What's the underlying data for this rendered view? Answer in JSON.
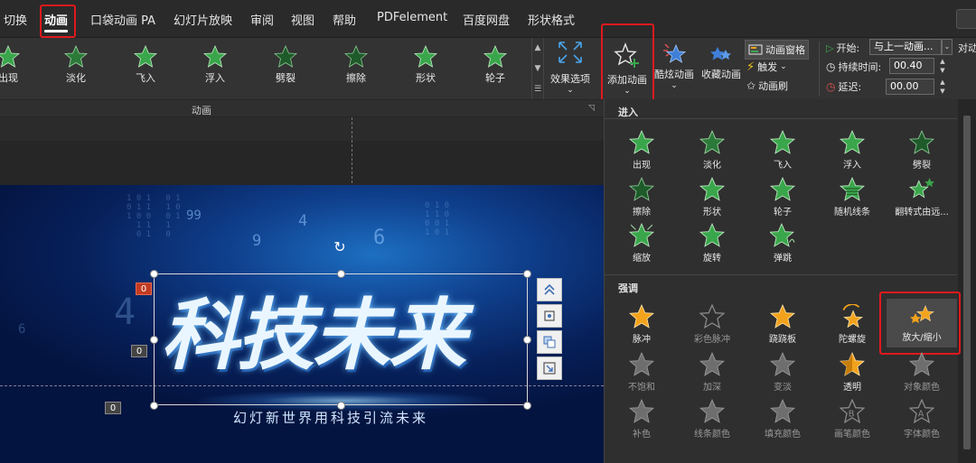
{
  "menu": {
    "tabs": [
      "切换",
      "动画",
      "口袋动画 PA",
      "幻灯片放映",
      "审阅",
      "视图",
      "帮助",
      "PDFelement",
      "百度网盘",
      "形状格式"
    ]
  },
  "ribbon": {
    "gallery": [
      "出现",
      "淡化",
      "飞入",
      "浮入",
      "劈裂",
      "擦除",
      "形状",
      "轮子"
    ],
    "effect_options_label": "效果选项",
    "add_animation_label": "添加动画",
    "cool_animation_label": "酷炫动画",
    "favorite_animation_label": "收藏动画",
    "animation_pane_label": "动画窗格",
    "trigger_label": "触发",
    "animation_painter_label": "动画刷",
    "start_label": "开始:",
    "start_value": "与上一动画...",
    "duration_label": "持续时间:",
    "duration_value": "00.40",
    "delay_label": "延迟:",
    "delay_value": "00.00",
    "reorder_label": "对动",
    "group_label": "动画"
  },
  "slide": {
    "title": "科技未来",
    "subtitle": "幻灯新世界用科技引流未来",
    "numbers": [
      "99",
      "9",
      "4",
      "6",
      "4",
      "6"
    ],
    "tags": [
      "0",
      "0",
      "0"
    ]
  },
  "panel": {
    "entrance_title": "进入",
    "entrance_items": [
      "出现",
      "淡化",
      "飞入",
      "浮入",
      "劈裂",
      "擦除",
      "形状",
      "轮子",
      "随机线条",
      "翻转式由远...",
      "缩放",
      "旋转",
      "弹跳"
    ],
    "emphasis_title": "强调",
    "emphasis_items": [
      "脉冲",
      "彩色脉冲",
      "跷跷板",
      "陀螺旋",
      "放大/缩小",
      "不饱和",
      "加深",
      "变淡",
      "透明",
      "对象颜色",
      "补色",
      "线条颜色",
      "填充颜色",
      "画笔颜色",
      "字体颜色"
    ]
  },
  "colors": {
    "entrance_star": "#3aa64b",
    "emphasis_star": "#f2a21b",
    "disabled_star": "#7a7a7a",
    "highlight_box": "#e0191d"
  }
}
